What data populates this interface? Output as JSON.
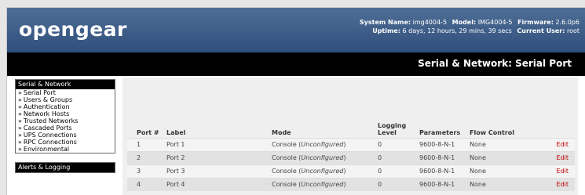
{
  "header": {
    "logo": "opengear",
    "system_name_label": "System Name:",
    "system_name": "img4004-5",
    "model_label": "Model:",
    "model": "IMG4004-5",
    "firmware_label": "Firmware:",
    "firmware": "2.6.0p6",
    "uptime_label": "Uptime:",
    "uptime": "6 days, 12 hours, 29 mins, 39 secs",
    "current_user_label": "Current User:",
    "current_user": "root"
  },
  "page_title": "Serial & Network: Serial Port",
  "sidebar": {
    "group1": {
      "title": "Serial & Network",
      "items": [
        {
          "label": "Serial Port"
        },
        {
          "label": "Users & Groups"
        },
        {
          "label": "Authentication"
        },
        {
          "label": "Network Hosts"
        },
        {
          "label": "Trusted Networks"
        },
        {
          "label": "Cascaded Ports"
        },
        {
          "label": "UPS Connections"
        },
        {
          "label": "RPC Connections"
        },
        {
          "label": "Environmental"
        }
      ]
    },
    "group2": {
      "title": "Alerts & Logging"
    },
    "bullet": "»"
  },
  "table": {
    "headers": {
      "port": "Port #",
      "label": "Label",
      "mode": "Mode",
      "logging": "Logging Level",
      "parameters": "Parameters",
      "flow": "Flow Control"
    },
    "rows": [
      {
        "port": "1",
        "label": "Port 1",
        "mode": "Console (",
        "mode_state": "Unconfigured",
        "mode_close": ")",
        "logging": "0",
        "parameters": "9600-8-N-1",
        "flow": "None",
        "edit": "Edit"
      },
      {
        "port": "2",
        "label": "Port 2",
        "mode": "Console (",
        "mode_state": "Unconfigured",
        "mode_close": ")",
        "logging": "0",
        "parameters": "9600-8-N-1",
        "flow": "None",
        "edit": "Edit"
      },
      {
        "port": "3",
        "label": "Port 3",
        "mode": "Console (",
        "mode_state": "Unconfigured",
        "mode_close": ")",
        "logging": "0",
        "parameters": "9600-8-N-1",
        "flow": "None",
        "edit": "Edit"
      },
      {
        "port": "4",
        "label": "Port 4",
        "mode": "Console (",
        "mode_state": "Unconfigured",
        "mode_close": ")",
        "logging": "0",
        "parameters": "9600-8-N-1",
        "flow": "None",
        "edit": "Edit"
      }
    ]
  }
}
